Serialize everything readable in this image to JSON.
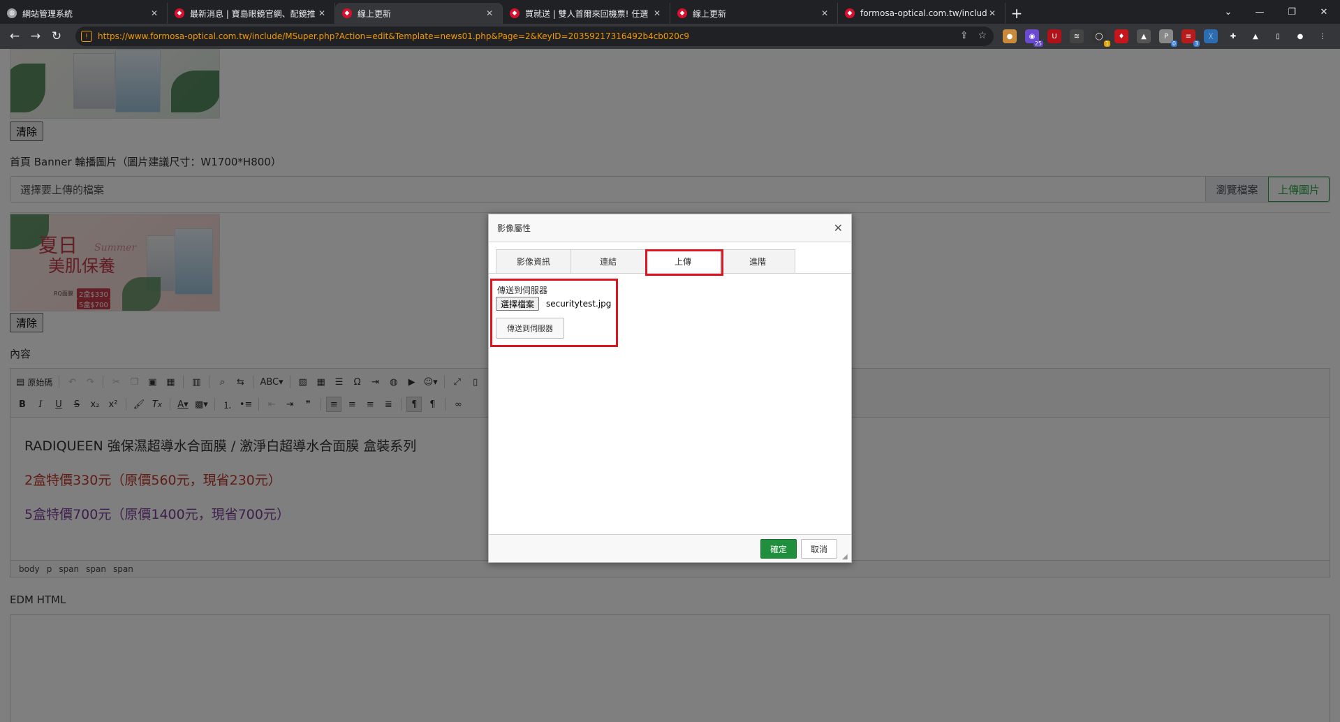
{
  "browser": {
    "tabs": [
      {
        "title": "網站管理系統",
        "favicon": "globe-icon",
        "active": false
      },
      {
        "title": "最新消息 | 寶島眼鏡官網、配鏡推",
        "favicon": "formosa-icon",
        "active": false
      },
      {
        "title": "線上更新",
        "favicon": "formosa-icon",
        "active": true
      },
      {
        "title": "買就送 | 雙人首爾來回機票! 任選",
        "favicon": "formosa-icon",
        "active": false
      },
      {
        "title": "線上更新",
        "favicon": "formosa-icon",
        "active": false
      },
      {
        "title": "formosa-optical.com.tw/includ",
        "favicon": "formosa-icon",
        "active": false
      }
    ],
    "new_tab": "+",
    "url": "https://www.formosa-optical.com.tw/include/MSuper.php?Action=edit&Template=news01.php&Page=2&KeyID=20359217316492b4cb020c9",
    "extension_badges": [
      "25",
      "1",
      "0",
      "3"
    ]
  },
  "page": {
    "clear_label": "清除",
    "banner_label": "首頁 Banner 輪播圖片（圖片建議尺寸：W1700*H800）",
    "file_placeholder": "選擇要上傳的檔案",
    "browse_label": "瀏覽檔案",
    "upload_label": "上傳圖片",
    "promo": {
      "title_line1": "夏日",
      "title_line2": "美肌保養",
      "script": "Summer",
      "brand": "RQ面膜",
      "price1": "2盒$330",
      "price2": "5盒$700"
    },
    "content_label": "內容",
    "edm_label": "EDM HTML"
  },
  "editor": {
    "source_label": "原始碼",
    "content": {
      "line1": "RADIQUEEN 強保濕超導水合面膜 / 激淨白超導水合面膜 盒裝系列",
      "line2": "2盒特價330元（原價560元，現省230元）",
      "line3": "5盒特價700元（原價1400元，現省700元）"
    },
    "path": [
      "body",
      "p",
      "span",
      "span",
      "span"
    ]
  },
  "dialog": {
    "title": "影像屬性",
    "tabs": [
      "影像資訊",
      "連結",
      "上傳",
      "進階"
    ],
    "active_tab": "上傳",
    "upload_label": "傳送到伺服器",
    "choose_file_label": "選擇檔案",
    "chosen_file": "securitytest.jpg",
    "send_button": "傳送到伺服器",
    "ok_label": "確定",
    "cancel_label": "取消"
  },
  "colors": {
    "highlight": "#e0141e",
    "ok_green": "#1f8f3e",
    "price_red": "#c0392b",
    "price_purple": "#7d3c98"
  }
}
